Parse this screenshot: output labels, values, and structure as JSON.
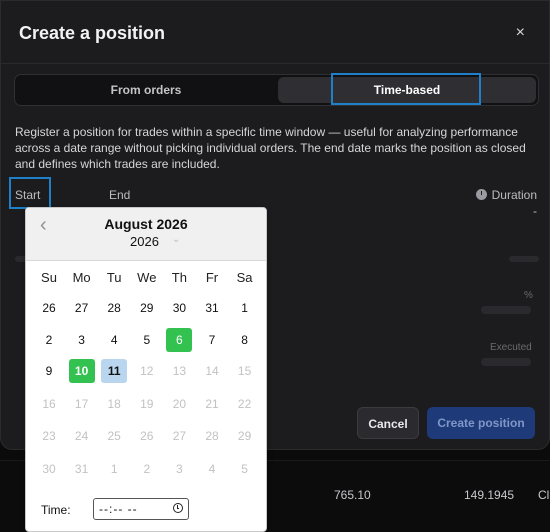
{
  "background": {
    "cell_1": "765.10",
    "cell_2": "149.1945",
    "cell_3": "Cl"
  },
  "modal": {
    "title": "Create a position",
    "close_glyph": "×",
    "tabs": [
      {
        "label": "From orders",
        "active": false
      },
      {
        "label": "Time-based",
        "active": true
      }
    ],
    "description": "Register a position for trades within a specific time window — useful for analyzing performance across a date range without picking individual orders. The end date marks the position as closed and defines which trades are included.",
    "start_label": "Start",
    "end_label": "End",
    "duration_label": "Duration",
    "duration_value": "-",
    "percent_symbol": "%",
    "executed_label": "Executed",
    "cancel_label": "Cancel",
    "create_label": "Create position"
  },
  "calendar": {
    "month_title": "August 2026",
    "year": "2026",
    "prev_glyph": "‹",
    "year_arrow": "⌄",
    "weekdays": [
      "Su",
      "Mo",
      "Tu",
      "We",
      "Th",
      "Fr",
      "Sa"
    ],
    "weeks": [
      [
        "26",
        "27",
        "28",
        "29",
        "30",
        "31",
        "1"
      ],
      [
        "2",
        "3",
        "4",
        "5",
        "6",
        "7",
        "8"
      ],
      [
        "9",
        "10",
        "11",
        "12",
        "13",
        "14",
        "15"
      ],
      [
        "16",
        "17",
        "18",
        "19",
        "20",
        "21",
        "22"
      ],
      [
        "23",
        "24",
        "25",
        "26",
        "27",
        "28",
        "29"
      ],
      [
        "30",
        "31",
        "1",
        "2",
        "3",
        "4",
        "5"
      ]
    ],
    "enabled_days": [
      "26",
      "27",
      "28",
      "29",
      "30",
      "31",
      "1",
      "2",
      "3",
      "4",
      "5",
      "6",
      "7",
      "8",
      "9",
      "10",
      "11"
    ],
    "today": "6",
    "selected": "10",
    "hover": "11",
    "time_label": "Time:",
    "time_value": "--:-- --",
    "colors": {
      "today": "#33c14f",
      "selected": "#33c14f",
      "hover": "#b9d6ee",
      "disabled": "#c2c2c2"
    }
  }
}
